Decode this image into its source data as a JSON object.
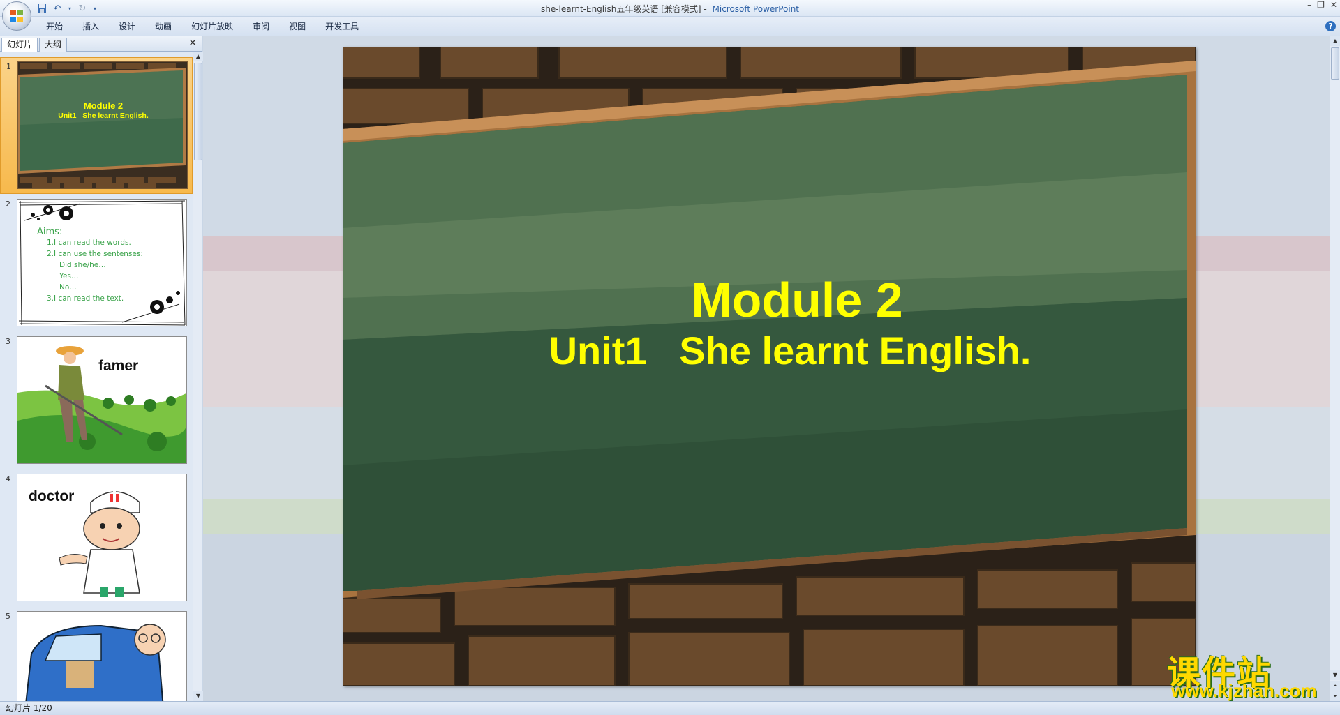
{
  "window": {
    "title_doc": "she-learnt-English五年级英语 [兼容模式]",
    "title_sep": "-",
    "title_app": "Microsoft PowerPoint"
  },
  "ribbon": {
    "tabs": [
      "开始",
      "插入",
      "设计",
      "动画",
      "幻灯片放映",
      "审阅",
      "视图",
      "开发工具"
    ]
  },
  "left_pane": {
    "tab_slides": "幻灯片",
    "tab_outline": "大纲",
    "slides": [
      {
        "num": "1",
        "title": "Module 2",
        "subtitle": "Unit1   She learnt English."
      },
      {
        "num": "2",
        "heading": "Aims:",
        "lines": [
          "1.I can read the words.",
          "2.I can use the sentenses:",
          "Did she/he…",
          "Yes…",
          "No…",
          "3.I can read the text."
        ]
      },
      {
        "num": "3",
        "label": "famer"
      },
      {
        "num": "4",
        "label": "doctor"
      },
      {
        "num": "5"
      }
    ]
  },
  "slide": {
    "title": "Module 2",
    "subtitle": "Unit1   She learnt English."
  },
  "status": {
    "slide_counter": "幻灯片 1/20"
  },
  "watermark": {
    "cn": "课件站",
    "url": "www.kjzhan.com"
  }
}
